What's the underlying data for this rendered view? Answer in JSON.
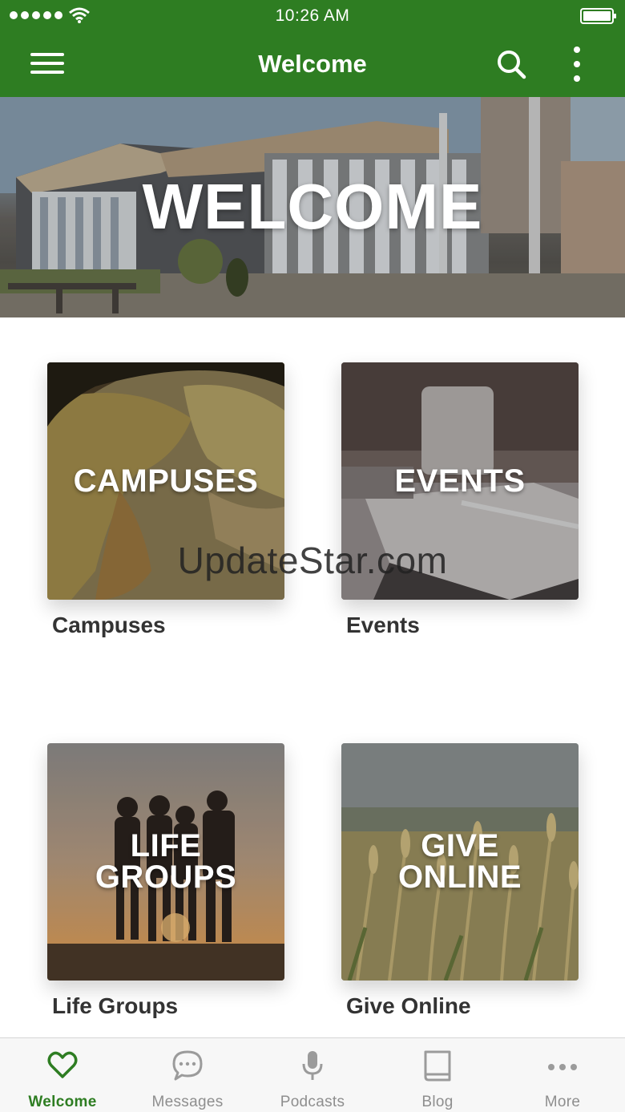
{
  "status_bar": {
    "time": "10:26 AM"
  },
  "nav_bar": {
    "title": "Welcome"
  },
  "hero": {
    "title": "WELCOME"
  },
  "tiles": [
    {
      "overlay": "CAMPUSES",
      "caption": "Campuses"
    },
    {
      "overlay": "EVENTS",
      "caption": "Events"
    },
    {
      "overlay": "LIFE GROUPS",
      "caption": "Life Groups"
    },
    {
      "overlay": "GIVE ONLINE",
      "caption": "Give Online"
    }
  ],
  "watermark": "UpdateStar.com",
  "tab_bar": {
    "tabs": [
      {
        "label": "Welcome",
        "icon": "heart-icon",
        "active": true
      },
      {
        "label": "Messages",
        "icon": "chat-bubble-icon",
        "active": false
      },
      {
        "label": "Podcasts",
        "icon": "microphone-icon",
        "active": false
      },
      {
        "label": "Blog",
        "icon": "book-icon",
        "active": false
      },
      {
        "label": "More",
        "icon": "ellipsis-icon",
        "active": false
      }
    ]
  },
  "colors": {
    "brand_green": "#2e7d22",
    "tab_inactive": "#8e8e8e",
    "caption_text": "#333333"
  }
}
